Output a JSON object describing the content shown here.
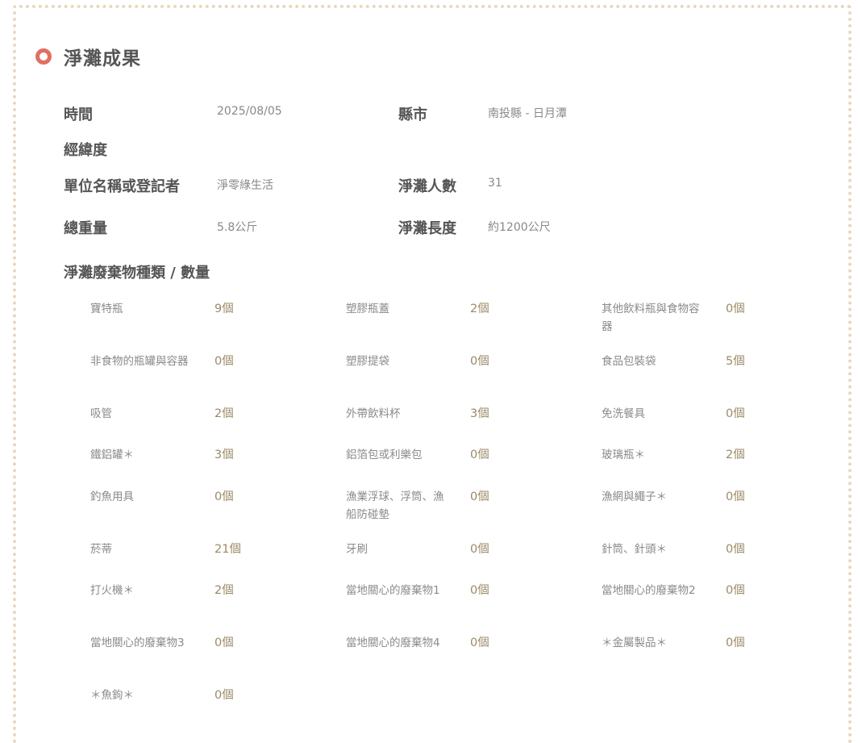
{
  "section": {
    "title": "淨灘成果"
  },
  "info": {
    "time_label": "時間",
    "time_value": "2025/08/05",
    "county_label": "縣市",
    "county_value": "南投縣 ‐ 日月潭",
    "coords_label": "經緯度",
    "unit_label": "單位名稱或登記者",
    "unit_value": "淨零綠生活",
    "people_label": "淨灘人數",
    "people_value": "31",
    "weight_label": "總重量",
    "weight_value": "5.8公斤",
    "length_label": "淨灘長度",
    "length_value": "約1200公尺"
  },
  "waste": {
    "title": "淨灘廢棄物種類 / 數量",
    "items": [
      {
        "name": "寶特瓶",
        "qty": "9個"
      },
      {
        "name": "塑膠瓶蓋",
        "qty": "2個"
      },
      {
        "name": "其他飲料瓶與食物容器",
        "qty": "0個"
      },
      {
        "name": "非食物的瓶罐與容器",
        "qty": "0個"
      },
      {
        "name": "塑膠提袋",
        "qty": "0個"
      },
      {
        "name": "食品包裝袋",
        "qty": "5個"
      },
      {
        "name": "吸管",
        "qty": "2個"
      },
      {
        "name": "外帶飲料杯",
        "qty": "3個"
      },
      {
        "name": "免洗餐具",
        "qty": "0個"
      },
      {
        "name": "鐵鋁罐＊",
        "qty": "3個"
      },
      {
        "name": "鋁箔包或利樂包",
        "qty": "0個"
      },
      {
        "name": "玻璃瓶＊",
        "qty": "2個"
      },
      {
        "name": "釣魚用具",
        "qty": "0個"
      },
      {
        "name": "漁業浮球、浮筒、漁船防碰墊",
        "qty": "0個"
      },
      {
        "name": "漁網與繩子＊",
        "qty": "0個"
      },
      {
        "name": "菸蒂",
        "qty": "21個"
      },
      {
        "name": "牙刷",
        "qty": "0個"
      },
      {
        "name": "針筒、針頭＊",
        "qty": "0個"
      },
      {
        "name": "打火機＊",
        "qty": "2個"
      },
      {
        "name": "當地關心的廢棄物1",
        "qty": "0個"
      },
      {
        "name": "當地關心的廢棄物2",
        "qty": "0個"
      },
      {
        "name": "當地關心的廢棄物3",
        "qty": "0個"
      },
      {
        "name": "當地關心的廢棄物4",
        "qty": "0個"
      },
      {
        "name": "＊金屬製品＊",
        "qty": "0個"
      },
      {
        "name": "＊魚鉤＊",
        "qty": "0個"
      }
    ]
  }
}
